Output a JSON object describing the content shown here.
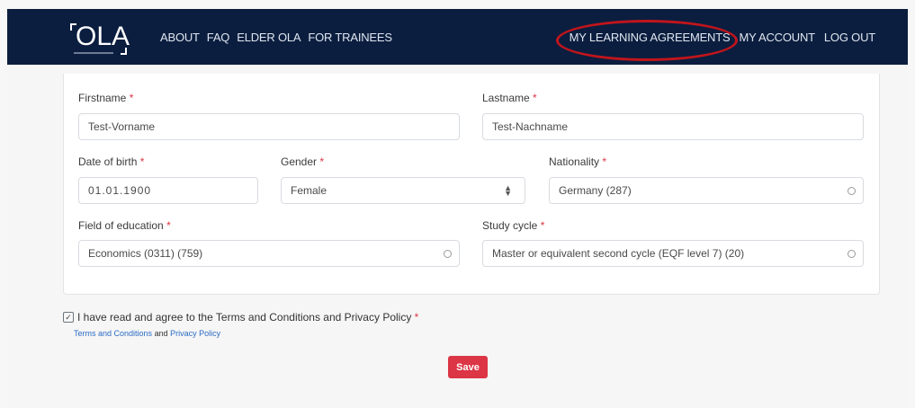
{
  "header": {
    "logo_text": "OLA",
    "nav_left": [
      "ABOUT",
      "FAQ",
      "ELDER OLA",
      "FOR TRAINEES"
    ],
    "nav_right": [
      "MY LEARNING AGREEMENTS",
      "MY ACCOUNT",
      "LOG OUT"
    ]
  },
  "form": {
    "firstname": {
      "label": "Firstname",
      "value": "Test-Vorname"
    },
    "lastname": {
      "label": "Lastname",
      "value": "Test-Nachname"
    },
    "date_of_birth": {
      "label": "Date of birth",
      "value": "01.01.1900"
    },
    "gender": {
      "label": "Gender",
      "value": "Female"
    },
    "nationality": {
      "label": "Nationality",
      "value": "Germany (287)"
    },
    "field_of_education": {
      "label": "Field of education",
      "value": "Economics (0311) (759)"
    },
    "study_cycle": {
      "label": "Study cycle",
      "value": "Master or equivalent second cycle (EQF level 7) (20)"
    },
    "required_mark": "*"
  },
  "agreement": {
    "checked": true,
    "text": "I have read and agree to the Terms and Conditions and Privacy Policy",
    "terms_link": "Terms and Conditions",
    "and_text": "and",
    "privacy_link": "Privacy Policy"
  },
  "save_label": "Save",
  "colors": {
    "header_bg": "#0b1e3f",
    "required": "#dc3545",
    "save_button": "#dc3545",
    "highlight": "#c0151c",
    "link": "#2b6cc4"
  }
}
